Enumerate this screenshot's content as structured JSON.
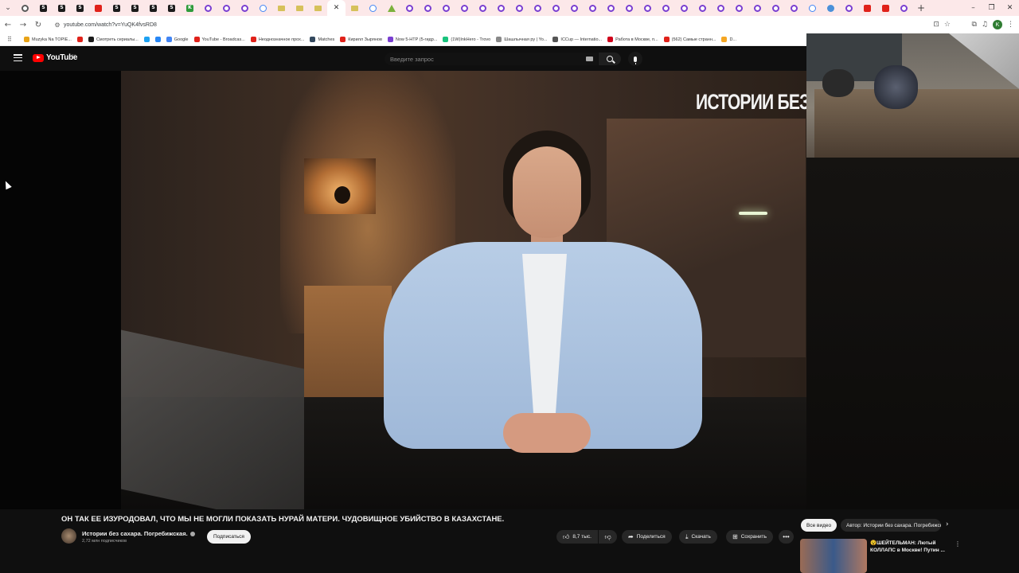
{
  "browser": {
    "url": "youtube.com/watch?v=YuQK4fvsRD8",
    "tabs": [
      {
        "icon": "grey"
      },
      {
        "icon": "s",
        "glyph": "S"
      },
      {
        "icon": "s",
        "glyph": "S"
      },
      {
        "icon": "s",
        "glyph": "S"
      },
      {
        "icon": "yt"
      },
      {
        "icon": "s",
        "glyph": "S"
      },
      {
        "icon": "s",
        "glyph": "S"
      },
      {
        "icon": "s",
        "glyph": "S"
      },
      {
        "icon": "s",
        "glyph": "S"
      },
      {
        "icon": "green",
        "glyph": "K"
      },
      {
        "icon": "ring"
      },
      {
        "icon": "ring"
      },
      {
        "icon": "ring"
      },
      {
        "icon": "g"
      },
      {
        "icon": "folder"
      },
      {
        "icon": "folder"
      },
      {
        "icon": "folder"
      },
      {
        "icon": "active"
      },
      {
        "icon": "folder"
      },
      {
        "icon": "g"
      },
      {
        "icon": "tri"
      },
      {
        "icon": "ring"
      },
      {
        "icon": "ring"
      },
      {
        "icon": "ring"
      },
      {
        "icon": "ring"
      },
      {
        "icon": "ring"
      },
      {
        "icon": "ring"
      },
      {
        "icon": "ring"
      },
      {
        "icon": "ring"
      },
      {
        "icon": "ring"
      },
      {
        "icon": "ring"
      },
      {
        "icon": "ring"
      },
      {
        "icon": "ring"
      },
      {
        "icon": "ring"
      },
      {
        "icon": "ring"
      },
      {
        "icon": "ring"
      },
      {
        "icon": "ring"
      },
      {
        "icon": "ring"
      },
      {
        "icon": "ring"
      },
      {
        "icon": "ring"
      },
      {
        "icon": "ring"
      },
      {
        "icon": "ring"
      },
      {
        "icon": "ring"
      },
      {
        "icon": "g"
      },
      {
        "icon": "circle"
      },
      {
        "icon": "ring"
      },
      {
        "icon": "yt"
      },
      {
        "icon": "yt"
      },
      {
        "icon": "ring"
      }
    ],
    "bookmarks": [
      {
        "label": "Muzyka Na TOPIE...",
        "color": "#e8a317"
      },
      {
        "label": "",
        "color": "#e0221a"
      },
      {
        "label": "Смотреть сериалы...",
        "color": "#1b1b1b"
      },
      {
        "label": "",
        "color": "#1da1f2"
      },
      {
        "label": "",
        "color": "#2787f5"
      },
      {
        "label": "Google",
        "color": "#4285f4"
      },
      {
        "label": "YouTube - Broadcas...",
        "color": "#e0221a"
      },
      {
        "label": "Неоднозначное прох...",
        "color": "#e0221a"
      },
      {
        "label": "Matches",
        "color": "#34495e"
      },
      {
        "label": "Кирилл Зырянов",
        "color": "#e0221a"
      },
      {
        "label": "Now 5-HTP (5-гидр...",
        "color": "#7a3fd1"
      },
      {
        "label": "(1W)InkHero - Trovo",
        "color": "#19c37d"
      },
      {
        "label": "Шашлычная ру | Yo...",
        "color": "#888888"
      },
      {
        "label": "ICCup — Internatio...",
        "color": "#555555"
      },
      {
        "label": "Работа в Москве, п...",
        "color": "#d0021b"
      },
      {
        "label": "(562) Самые странн...",
        "color": "#e0221a"
      },
      {
        "label": "D...",
        "color": "#f5a623"
      }
    ]
  },
  "youtube": {
    "logo_text": "YouTube",
    "country_code": "BY",
    "search_placeholder": "Введите запрос",
    "channel_sign": "ИСТОРИИ БЕЗ",
    "video_title": "ОН ТАК ЕЕ ИЗУРОДОВАЛ, ЧТО МЫ НЕ МОГЛИ ПОКАЗАТЬ НУРАЙ МАТЕРИ. ЧУДОВИЩНОЕ УБИЙСТВО В КАЗАХСТАНЕ.",
    "channel_name": "Истории без сахара. Погребижская.",
    "subscribers": "2,72 млн подписчиков",
    "subscribe_label": "Подписаться",
    "likes": "8,7 тыс.",
    "share_label": "Поделиться",
    "download_label": "Скачать",
    "save_label": "Сохранить",
    "chips": {
      "all": "Все видео",
      "author": "Автор: Истории без сахара. Погребижская."
    },
    "recommendation_title": "😵ШЕЙТЕЛЬМАН: Лютый КОЛЛАПС в Москве! Путин ..."
  }
}
